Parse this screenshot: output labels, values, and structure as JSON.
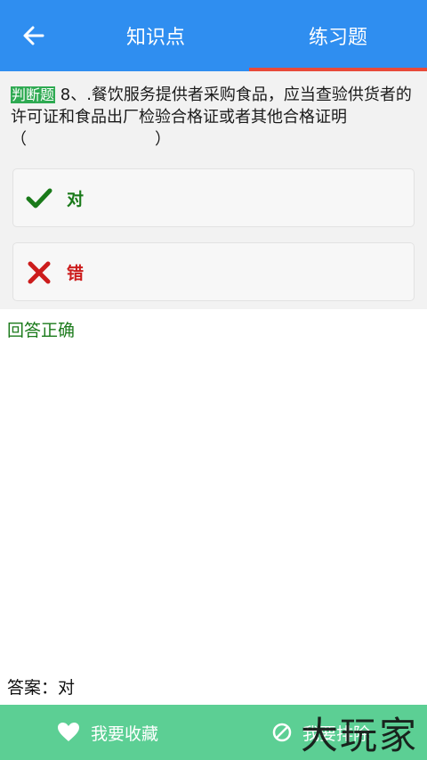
{
  "header": {
    "tabs": [
      {
        "label": "知识点"
      },
      {
        "label": "练习题"
      }
    ],
    "active_tab": "练习题",
    "colors": {
      "bar": "#2f8ef0",
      "active_underline": "#e84a3a"
    }
  },
  "question": {
    "type_badge": "判断题",
    "text": " 8、.餐饮服务提供者采购食品，应当查验供货者的许可证和食品出厂检验合格证或者其他合格证明",
    "blank": "（　　　　　　　　）"
  },
  "options": [
    {
      "label": "对",
      "icon": "check-icon",
      "color": "#1a7a1a"
    },
    {
      "label": "错",
      "icon": "cross-icon",
      "color": "#cc1c1c"
    }
  ],
  "result": {
    "text": "回答正确",
    "color": "#1b7a1b"
  },
  "answer": {
    "text": "答案：对"
  },
  "footer": {
    "favorite_label": "我要收藏",
    "exclude_label": "我要排除",
    "colors": {
      "bar": "#5ccf94"
    }
  },
  "watermark": {
    "text": "大玩家"
  }
}
